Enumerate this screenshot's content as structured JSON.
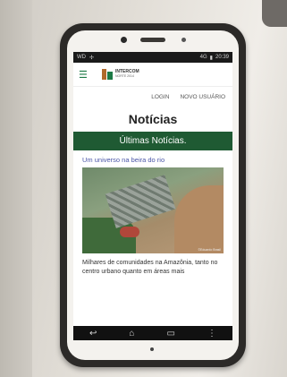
{
  "status_bar": {
    "carrier": "WD",
    "signal": "4G",
    "time": "20:39"
  },
  "header": {
    "logo_line1": "INTERCOM",
    "logo_line2": "NORTE 2014"
  },
  "nav": {
    "login": "LOGIN",
    "new_user": "NOVO USUÁRIO"
  },
  "page": {
    "title": "Notícias",
    "section_band": "Últimas Notícias."
  },
  "article": {
    "title": "Um universo na beira do rio",
    "photo_credit": "©Eduardo Brasil",
    "body": "Milhares de comunidades na Amazônia, tanto no centro urbano quanto em áreas mais"
  },
  "colors": {
    "brand_green": "#1f5a33",
    "link_blue": "#4b56a8",
    "menu_green": "#1d7a46"
  },
  "icons": {
    "menu": "hamburger-menu-icon",
    "back": "back-icon",
    "home": "home-icon",
    "recents": "recent-apps-icon",
    "overflow": "overflow-menu-icon"
  }
}
